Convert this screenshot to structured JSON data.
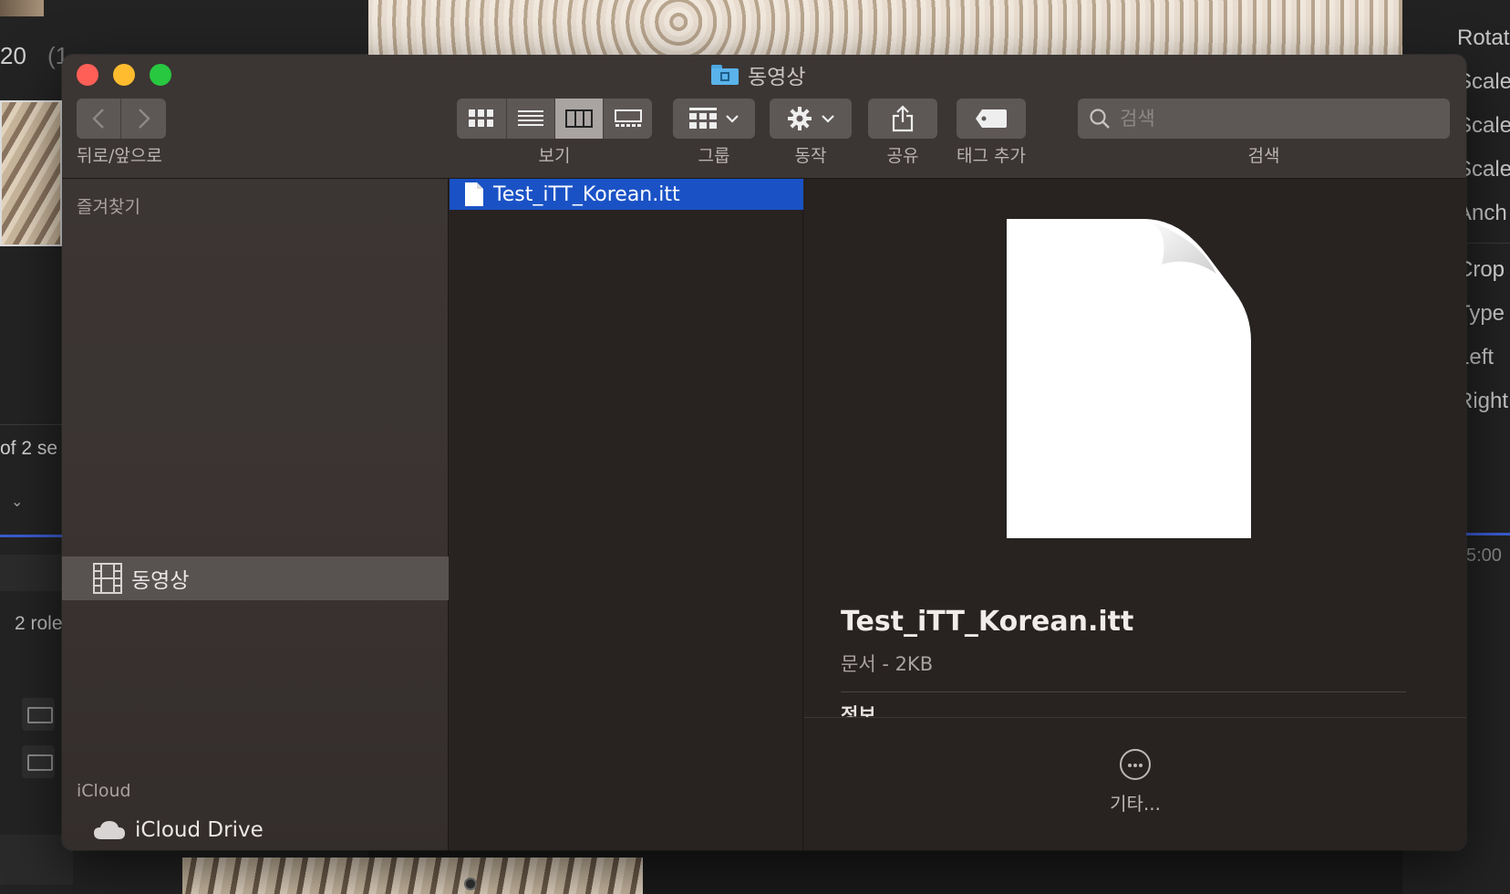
{
  "background": {
    "left_number": "20",
    "left_number_suffix": "(1",
    "of_text": "of 2 se",
    "roles_text": "2 role",
    "inspector": [
      "Rotat",
      "Scale",
      "Scale",
      "Scale",
      "Anch",
      "Crop",
      "Type",
      "Left",
      "Right"
    ],
    "timecode": "5:00"
  },
  "window": {
    "title": "동영상",
    "toolbar": {
      "nav_label": "뒤로/앞으로",
      "view_label": "보기",
      "group_label": "그룹",
      "action_label": "동작",
      "share_label": "공유",
      "tag_label": "태그 추가",
      "search_label": "검색",
      "search_placeholder": "검색"
    },
    "sidebar": {
      "favorites_heading": "즐겨찾기",
      "favorites": [
        {
          "label": "동영상",
          "icon": "film-icon",
          "selected": true
        }
      ],
      "icloud_heading": "iCloud",
      "icloud": [
        {
          "label": "iCloud Drive",
          "icon": "cloud-icon"
        }
      ]
    },
    "files": [
      {
        "name": "Test_iTT_Korean.itt",
        "selected": true
      }
    ],
    "preview": {
      "name": "Test_iTT_Korean.itt",
      "meta": "문서 - 2KB",
      "info_heading": "정보",
      "more_label": "기타..."
    }
  },
  "colors": {
    "selection_blue": "#1a52c6",
    "close": "#ff5f57",
    "minimize": "#febc2e",
    "maximize": "#28c840"
  }
}
